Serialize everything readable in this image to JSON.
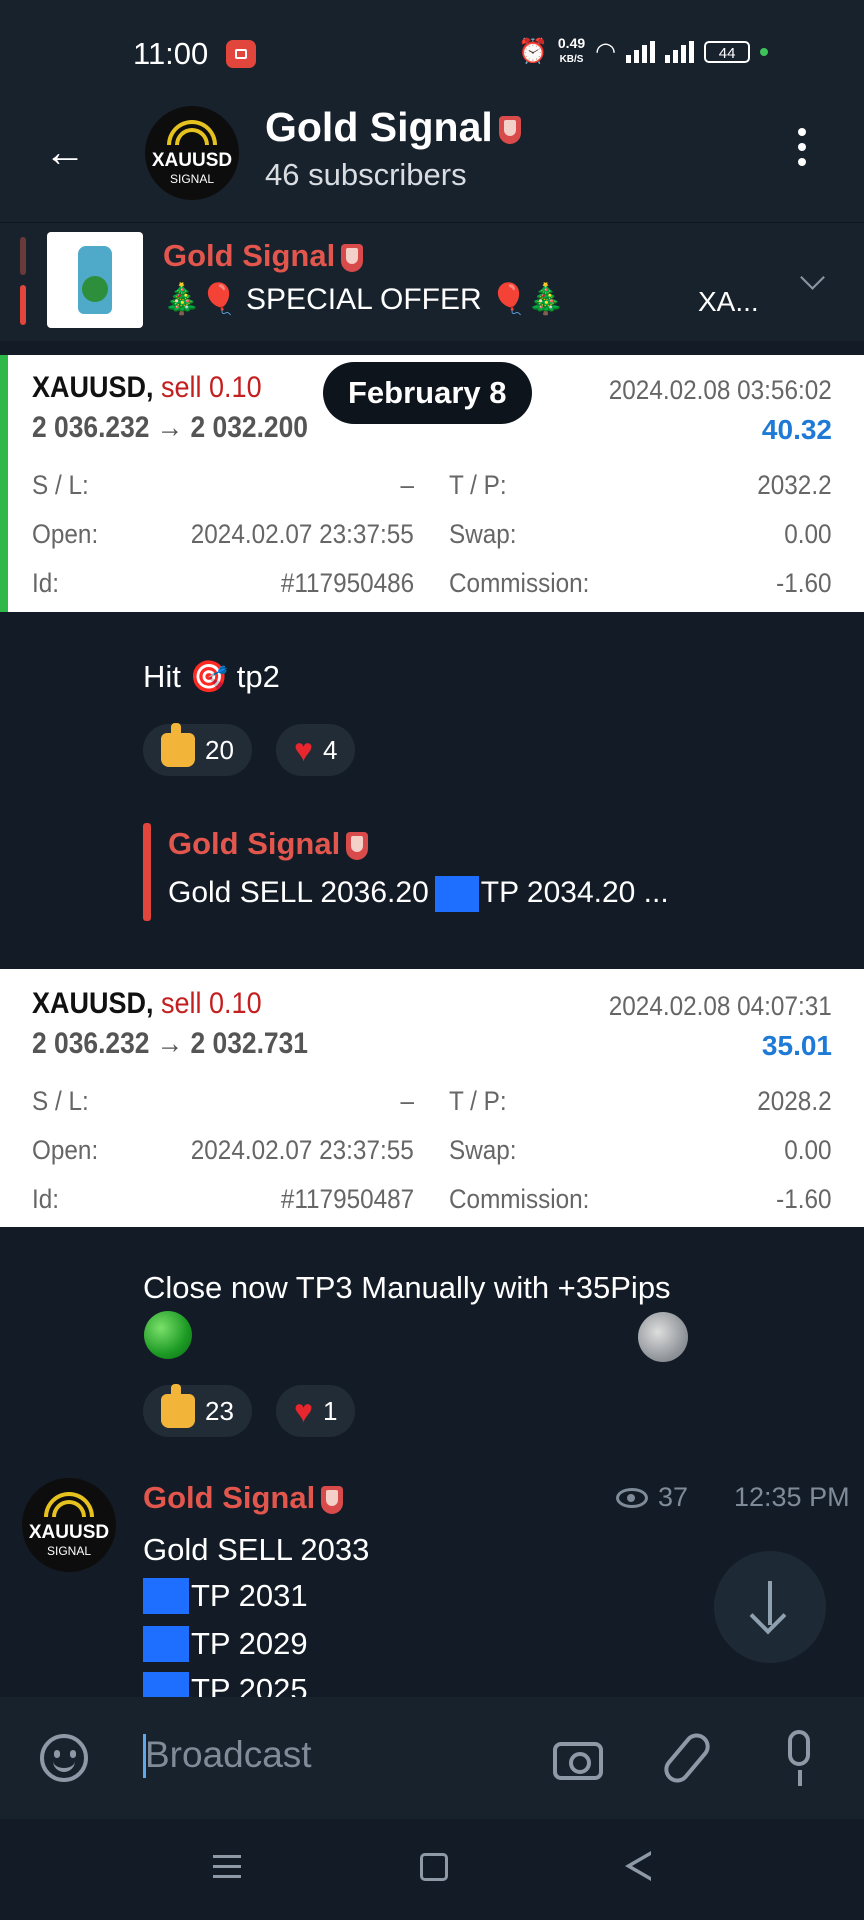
{
  "status": {
    "time": "11:00",
    "net_speed_value": "0.49",
    "net_speed_unit": "KB/S",
    "battery": "44"
  },
  "header": {
    "title": "Gold Signal",
    "subscribers": "46 subscribers",
    "avatar_text_1": "XAUUSD",
    "avatar_text_2": "SIGNAL"
  },
  "pinned": {
    "name": "Gold Signal",
    "text": "🎄🎈 SPECIAL OFFER 🎈🎄",
    "trailing": "XA..."
  },
  "date_pill": "February 8",
  "trade1": {
    "symbol": "XAUUSD,",
    "side": "sell 0.10",
    "prices": "2 036.232 → 2 032.200",
    "datetime": "2024.02.08 03:56:02",
    "profit": "40.32",
    "sl_label": "S / L:",
    "sl_value": "–",
    "tp_label": "T / P:",
    "tp_value": "2032.2",
    "open_label": "Open:",
    "open_value": "2024.02.07 23:37:55",
    "swap_label": "Swap:",
    "swap_value": "0.00",
    "id_label": "Id:",
    "id_value": "#117950486",
    "comm_label": "Commission:",
    "comm_value": "-1.60"
  },
  "msg1": {
    "text_a": "Hit",
    "text_b": "tp2",
    "likes": "20",
    "hearts": "4"
  },
  "reply": {
    "name": "Gold Signal",
    "text_a": "Gold   SELL 2036.20",
    "text_b": "TP 2034.20 ..."
  },
  "trade2": {
    "symbol": "XAUUSD,",
    "side": "sell 0.10",
    "prices": "2 036.232 → 2 032.731",
    "datetime": "2024.02.08 04:07:31",
    "profit": "35.01",
    "sl_label": "S / L:",
    "sl_value": "–",
    "tp_label": "T / P:",
    "tp_value": "2028.2",
    "open_label": "Open:",
    "open_value": "2024.02.07 23:37:55",
    "swap_label": "Swap:",
    "swap_value": "0.00",
    "id_label": "Id:",
    "id_value": "#117950487",
    "comm_label": "Commission:",
    "comm_value": "-1.60"
  },
  "msg2": {
    "text": "Close now TP3 Manually with +35Pips",
    "likes": "23",
    "hearts": "1"
  },
  "last_post": {
    "name": "Gold Signal",
    "views": "37",
    "time": "12:35 PM",
    "line1": "Gold   SELL 2033",
    "tp1": "TP 2031",
    "tp2": "TP 2029",
    "tp3": "TP 2025"
  },
  "input": {
    "placeholder": "Broadcast"
  },
  "icons": [
    "back-arrow-icon",
    "kebab-menu-icon",
    "chevron-down-icon",
    "eye-icon",
    "scroll-down-arrow-icon",
    "emoji-icon",
    "camera-icon",
    "paperclip-icon",
    "microphone-icon"
  ],
  "colors": {
    "background": "#131c26",
    "bar": "#18222d",
    "channel_name": "#e2564d",
    "profit_blue": "#1e7ad6",
    "sell_red": "#c41f1f",
    "accent_green": "#2fb84a"
  }
}
